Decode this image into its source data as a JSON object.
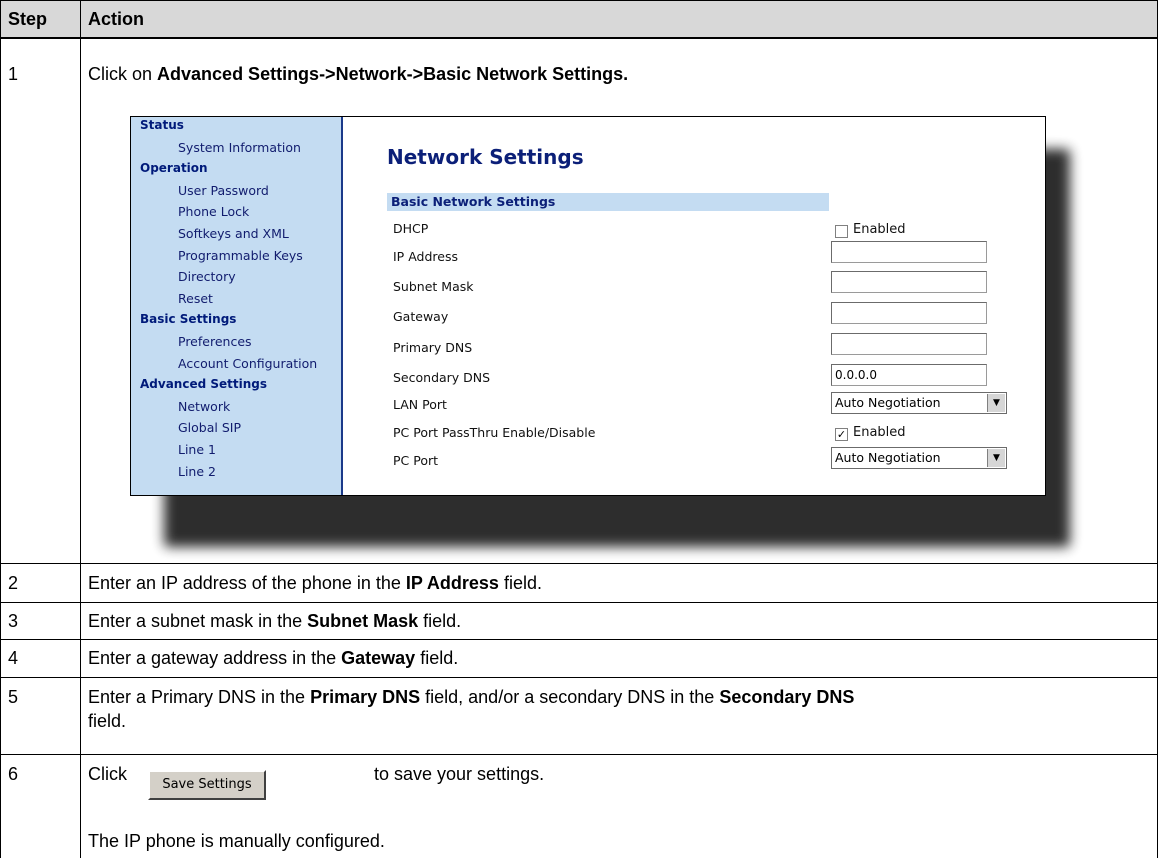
{
  "table": {
    "header": {
      "step": "Step",
      "action": "Action"
    },
    "rows": [
      {
        "step": "1",
        "pre": "Click on ",
        "bold": "Advanced Settings->Network->Basic Network Settings.",
        "post": ""
      },
      {
        "step": "2",
        "pre": "Enter an IP address of the phone in the ",
        "bold": "IP Address",
        "post": " field."
      },
      {
        "step": "3",
        "pre": "Enter a subnet mask in the ",
        "bold": "Subnet Mask",
        "post": " field."
      },
      {
        "step": "4",
        "pre": "Enter a gateway address in the ",
        "bold": "Gateway",
        "post": " field."
      },
      {
        "step": "5",
        "pre": "Enter a Primary DNS in the ",
        "bold1": "Primary DNS",
        "mid": " field, and/or a secondary DNS in the ",
        "bold2": "Secondary DNS",
        "line2": "field."
      },
      {
        "step": "6",
        "click": "Click",
        "after": "to save your settings.",
        "note": "The IP phone is manually configured."
      }
    ],
    "save_button_label": "Save Settings"
  },
  "screenshot": {
    "sidebar": [
      {
        "type": "h",
        "label": "Status"
      },
      {
        "type": "i",
        "label": "System Information"
      },
      {
        "type": "h",
        "label": "Operation"
      },
      {
        "type": "i",
        "label": "User Password"
      },
      {
        "type": "i",
        "label": "Phone Lock"
      },
      {
        "type": "i",
        "label": "Softkeys and XML"
      },
      {
        "type": "i",
        "label": "Programmable Keys"
      },
      {
        "type": "i",
        "label": "Directory"
      },
      {
        "type": "i",
        "label": "Reset"
      },
      {
        "type": "h",
        "label": "Basic Settings"
      },
      {
        "type": "i",
        "label": "Preferences"
      },
      {
        "type": "i",
        "label": "Account Configuration"
      },
      {
        "type": "h",
        "label": "Advanced Settings"
      },
      {
        "type": "i",
        "label": "Network"
      },
      {
        "type": "i",
        "label": "Global SIP"
      },
      {
        "type": "i",
        "label": "Line 1"
      },
      {
        "type": "i",
        "label": "Line 2"
      }
    ],
    "title": "Network Settings",
    "section": "Basic Network Settings",
    "fields": {
      "dhcp": {
        "label": "DHCP",
        "checked": false,
        "option": "Enabled"
      },
      "ip_address": {
        "label": "IP Address",
        "value": ""
      },
      "subnet_mask": {
        "label": "Subnet Mask",
        "value": ""
      },
      "gateway": {
        "label": "Gateway",
        "value": ""
      },
      "primary_dns": {
        "label": "Primary DNS",
        "value": ""
      },
      "secondary_dns": {
        "label": "Secondary DNS",
        "value": "0.0.0.0"
      },
      "lan_port": {
        "label": "LAN Port",
        "value": "Auto Negotiation"
      },
      "pc_passthru": {
        "label": "PC Port PassThru Enable/Disable",
        "checked": true,
        "option": "Enabled"
      },
      "pc_port": {
        "label": "PC Port",
        "value": "Auto Negotiation"
      }
    }
  }
}
